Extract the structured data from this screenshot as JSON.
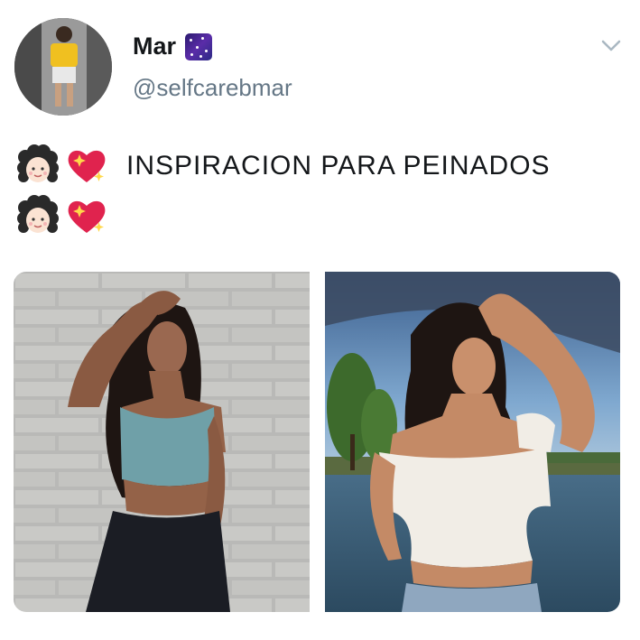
{
  "tweet": {
    "display_name": "Mar",
    "name_emoji": "milky-way-icon",
    "handle": "@selfcarebmar",
    "text": "INSPIRACION PARA PEINADOS",
    "line_emojis": [
      "woman-curly-hair-icon",
      "sparkling-heart-icon"
    ],
    "menu_icon": "chevron-down-icon",
    "photos": [
      "photo-brick-wall-pose",
      "photo-lake-sunset-pose"
    ]
  },
  "colors": {
    "text_primary": "#14171a",
    "text_secondary": "#657786",
    "chevron": "#aab8c2",
    "heart": "#e0234e"
  }
}
